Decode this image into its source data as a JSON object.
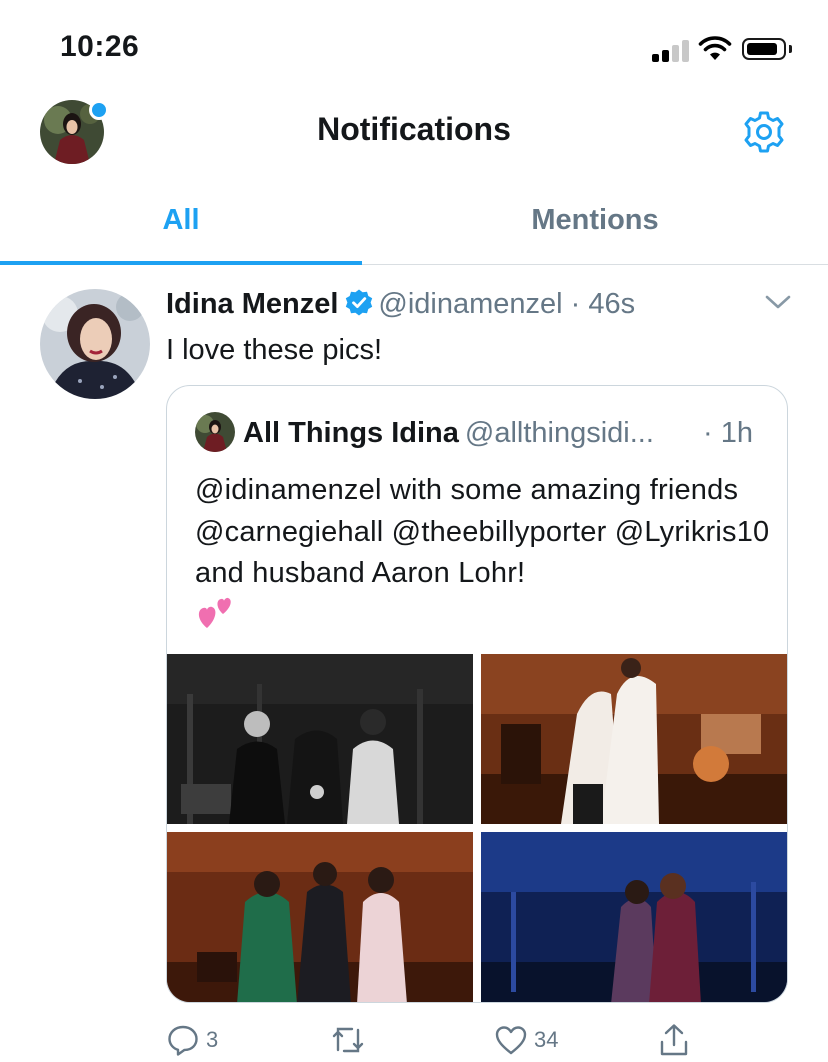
{
  "status_bar": {
    "time": "10:26"
  },
  "header": {
    "title": "Notifications"
  },
  "tabs": [
    {
      "label": "All",
      "active": true
    },
    {
      "label": "Mentions",
      "active": false
    }
  ],
  "tweet": {
    "author_name": "Idina Menzel",
    "handle": "@idinamenzel",
    "separator": " · ",
    "time": "46s",
    "text": "I love these pics!",
    "quoted": {
      "author_name": "All Things Idina",
      "handle": "@allthingsidi...",
      "time": "· 1h",
      "text": "@idinamenzel with  some amazing friends @carnegiehall @theebillyporter @Lyrikris10 and husband Aaron Lohr!",
      "emoji": "💕"
    },
    "actions": {
      "replies": "3",
      "retweets": "",
      "likes": "34"
    }
  },
  "colors": {
    "accent": "#1da1f2",
    "secondary_text": "#657786",
    "primary_text": "#14171a",
    "border": "#ccd6dd"
  },
  "icons": [
    "signal-icon",
    "wifi-icon",
    "battery-icon",
    "settings-gear-icon",
    "verified-badge-icon",
    "chevron-down-icon",
    "reply-icon",
    "retweet-icon",
    "like-icon",
    "share-icon"
  ]
}
